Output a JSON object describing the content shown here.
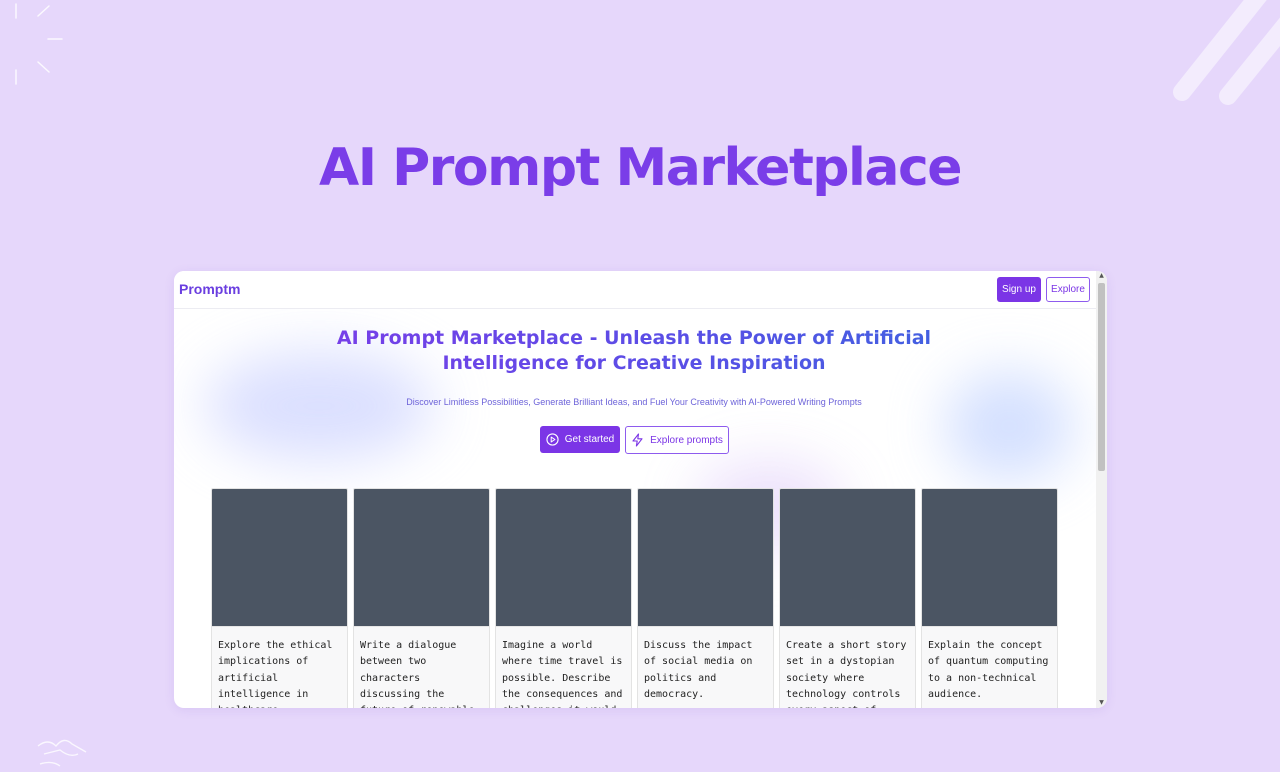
{
  "page": {
    "title": "AI Prompt Marketplace",
    "background": "#e6d7fb",
    "accent": "#7b35e6"
  },
  "site": {
    "brand": "Promptm",
    "nav": {
      "signup_label": "Sign up",
      "explore_label": "Explore"
    },
    "hero": {
      "heading": "AI Prompt Marketplace - Unleash the Power of Artificial Intelligence for Creative Inspiration",
      "subheading": "Discover Limitless Possibilities, Generate Brilliant Ideas, and Fuel Your Creativity with AI-Powered Writing Prompts",
      "get_started_label": "Get started",
      "explore_prompts_label": "Explore prompts",
      "get_started_icon": "play-circle-icon",
      "explore_prompts_icon": "lightning-bolt-icon"
    },
    "prompts": [
      {
        "text": "Explore the ethical implications of artificial intelligence in healthcare."
      },
      {
        "text": "Write a dialogue between two characters discussing the future of renewable energy."
      },
      {
        "text": "Imagine a world where time travel is possible. Describe the consequences and challenges it would bring."
      },
      {
        "text": "Discuss the impact of social media on politics and democracy."
      },
      {
        "text": "Create a short story set in a dystopian society where technology controls every aspect of life."
      },
      {
        "text": "Explain the concept of quantum computing to a non-technical audience."
      }
    ]
  }
}
